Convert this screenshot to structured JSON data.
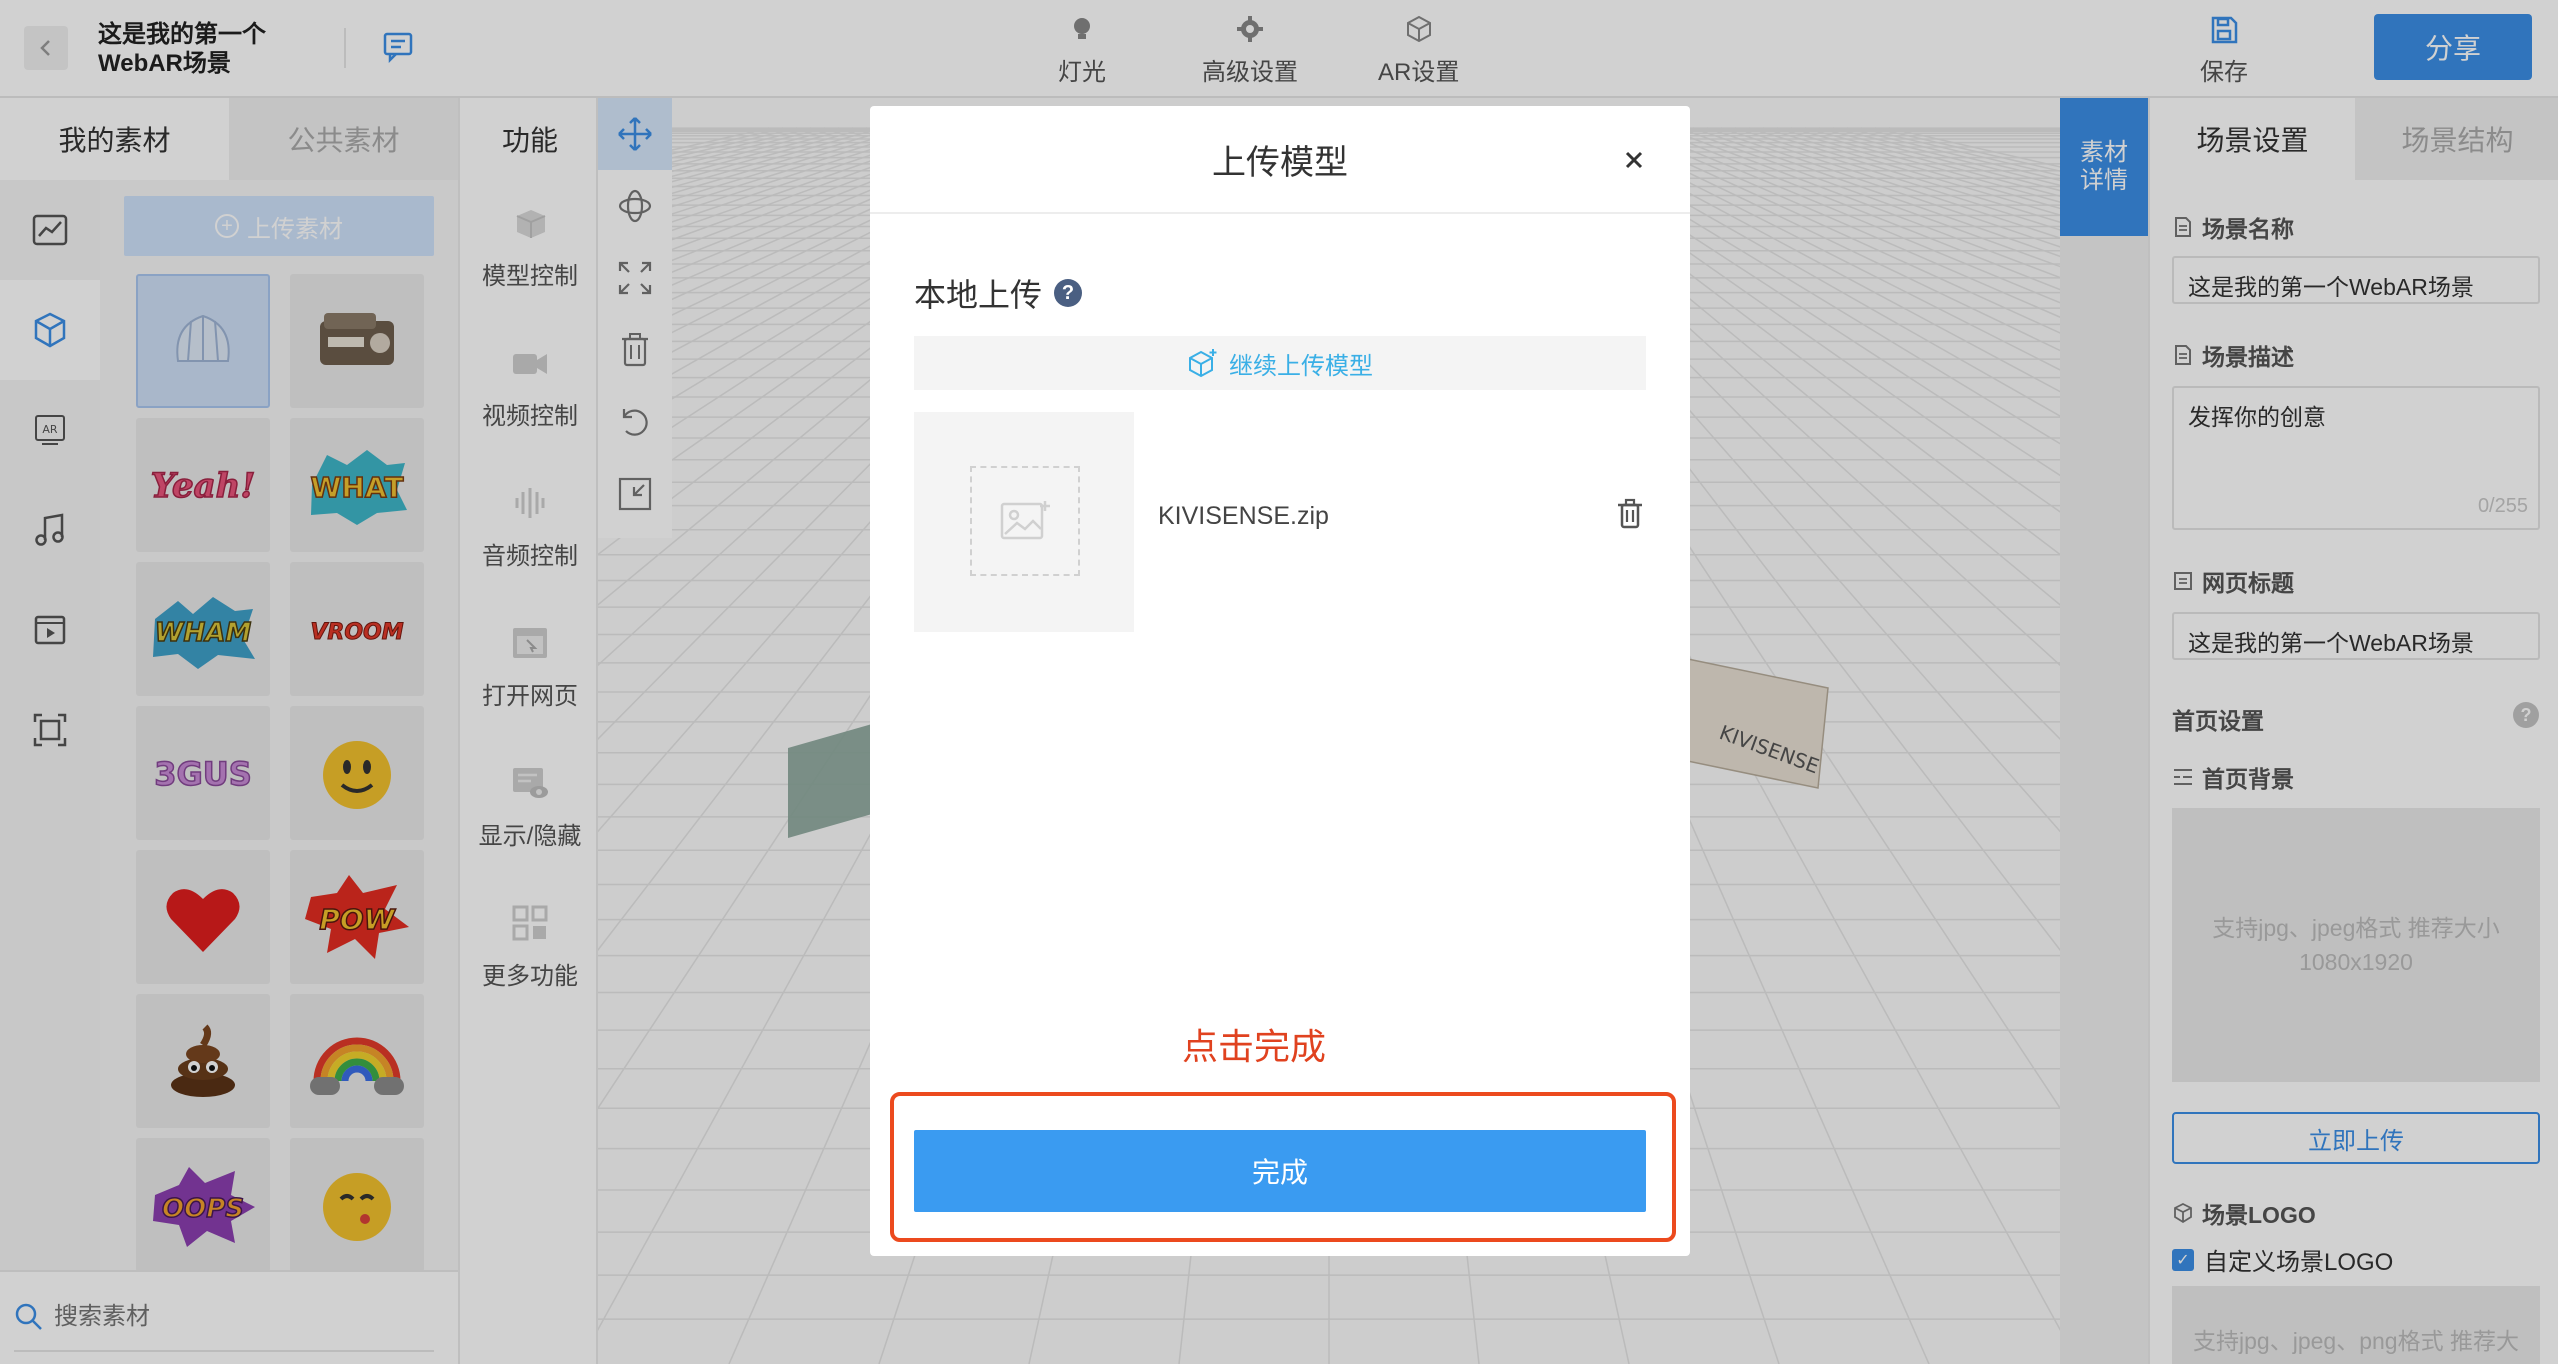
{
  "header": {
    "back_icon": "chevron-left-icon",
    "title_line1": "这是我的第一个",
    "title_line2": "WebAR场景",
    "comment_icon": "comment-icon",
    "tools": [
      {
        "label": "灯光",
        "icon": "bulb-icon"
      },
      {
        "label": "高级设置",
        "icon": "gear-icon"
      },
      {
        "label": "AR设置",
        "icon": "cube-icon"
      }
    ],
    "save_label": "保存",
    "share_label": "分享"
  },
  "materials": {
    "tabs": [
      "我的素材",
      "公共素材"
    ],
    "upload_label": "上传素材",
    "rail_icons": [
      "chart-icon",
      "cube-icon",
      "ar-icon",
      "music-icon",
      "video-icon",
      "scan-icon"
    ],
    "thumbnails": [
      "shell",
      "machine",
      "Yeah!",
      "WHAT",
      "WHAM",
      "VROOM",
      "3GUS",
      "smiley",
      "heart",
      "POW",
      "poop",
      "rainbow",
      "OOPS",
      "kiss"
    ],
    "search_placeholder": "搜索素材"
  },
  "functions": {
    "header": "功能",
    "items": [
      {
        "label": "模型控制",
        "icon": "cube-icon"
      },
      {
        "label": "视频控制",
        "icon": "camera-icon"
      },
      {
        "label": "音频控制",
        "icon": "audio-wave-icon"
      },
      {
        "label": "打开网页",
        "icon": "browser-icon"
      },
      {
        "label": "显示/隐藏",
        "icon": "visibility-icon"
      },
      {
        "label": "更多功能",
        "icon": "grid-icon"
      }
    ]
  },
  "toolbar": {
    "tools": [
      "move-icon",
      "rotate-icon",
      "scale-icon",
      "delete-icon",
      "undo-icon",
      "collapse-icon"
    ]
  },
  "right_panel": {
    "detail_tab": "素材详情",
    "tabs": [
      "场景设置",
      "场景结构"
    ],
    "scene_name_label": "场景名称",
    "scene_name_value": "这是我的第一个WebAR场景",
    "scene_desc_label": "场景描述",
    "scene_desc_value": "发挥你的创意",
    "scene_desc_counter": "0/255",
    "page_title_label": "网页标题",
    "page_title_value": "这是我的第一个WebAR场景",
    "home_settings_label": "首页设置",
    "home_bg_label": "首页背景",
    "home_bg_hint_line1": "支持jpg、jpeg格式 推荐大小",
    "home_bg_hint_line2": "1080x1920",
    "upload_now_label": "立即上传",
    "logo_label": "场景LOGO",
    "custom_logo_label": "自定义场景LOGO",
    "logo_hint": "支持jpg、jpeg、png格式 推荐大"
  },
  "modal": {
    "title": "上传模型",
    "close_icon": "close-icon",
    "local_upload_label": "本地上传",
    "help_symbol": "?",
    "continue_upload_label": "继续上传模型",
    "file_name": "KIVISENSE.zip",
    "hint": "点击完成",
    "done_label": "完成"
  },
  "colors": {
    "accent": "#3b8ee6",
    "done_button": "#3a9bf1",
    "highlight_red": "#ec4a1e"
  }
}
